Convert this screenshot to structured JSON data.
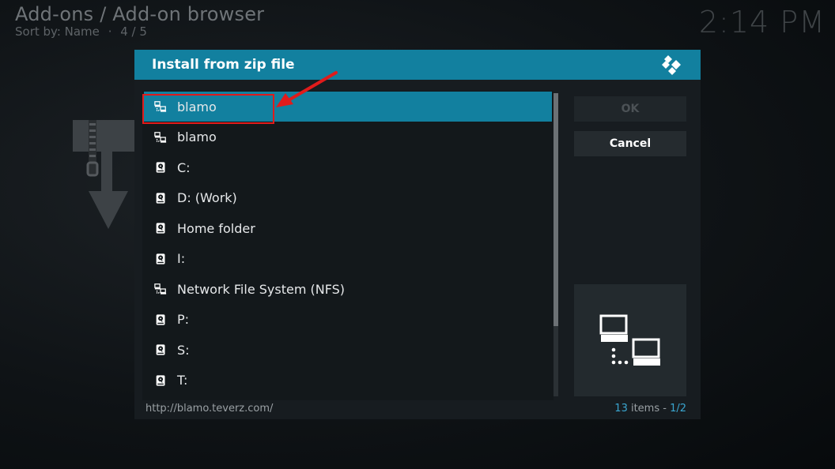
{
  "background": {
    "title": "Add-ons / Add-on browser",
    "sort_label": "Sort by: Name",
    "separator": "·",
    "page_position": "4 / 5",
    "clock": "2:14 PM"
  },
  "dialog": {
    "title": "Install from zip file",
    "items": [
      {
        "label": "blamo",
        "icon": "network-icon",
        "selected": true
      },
      {
        "label": "blamo",
        "icon": "network-icon",
        "selected": false
      },
      {
        "label": "C:",
        "icon": "hard-drive-icon",
        "selected": false
      },
      {
        "label": "D: (Work)",
        "icon": "hard-drive-icon",
        "selected": false
      },
      {
        "label": "Home folder",
        "icon": "hard-drive-icon",
        "selected": false
      },
      {
        "label": "I:",
        "icon": "hard-drive-icon",
        "selected": false
      },
      {
        "label": "Network File System (NFS)",
        "icon": "network-icon",
        "selected": false
      },
      {
        "label": "P:",
        "icon": "hard-drive-icon",
        "selected": false
      },
      {
        "label": "S:",
        "icon": "hard-drive-icon",
        "selected": false
      },
      {
        "label": "T:",
        "icon": "hard-drive-icon",
        "selected": false
      }
    ],
    "ok_label": "OK",
    "cancel_label": "Cancel",
    "footer": {
      "url": "http://blamo.teverz.com/",
      "item_count": "13",
      "items_text": " items - ",
      "page": "1/2"
    }
  },
  "colors": {
    "accent": "#12809f",
    "annotation": "#e01b1b"
  }
}
